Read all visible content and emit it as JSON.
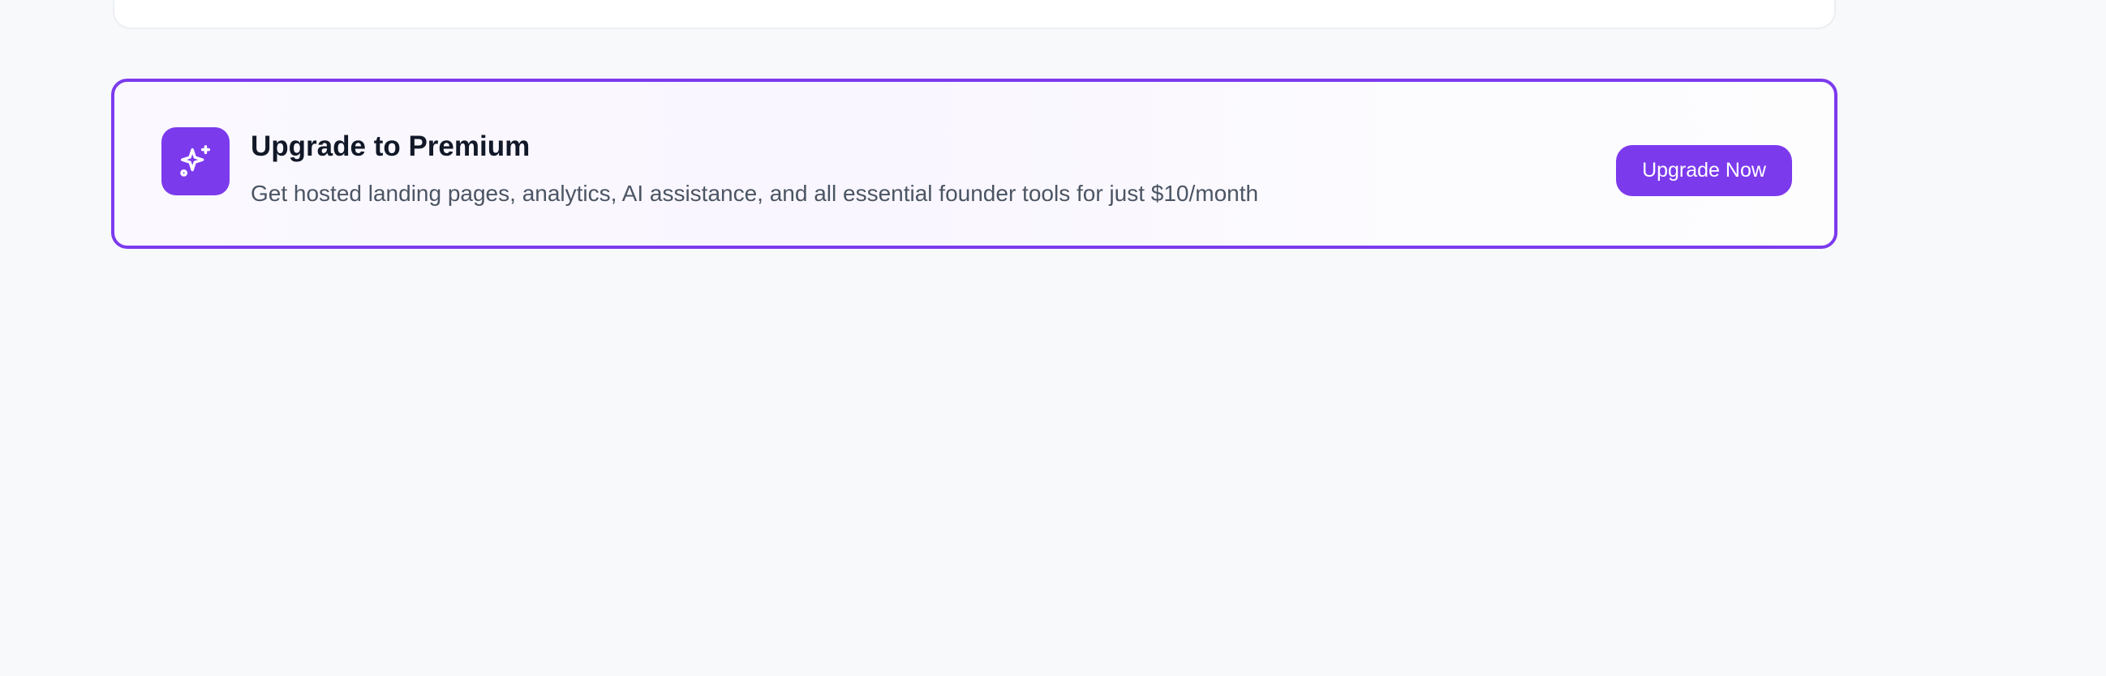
{
  "premium_banner": {
    "title": "Upgrade to Premium",
    "description": "Get hosted landing pages, analytics, AI assistance, and all essential founder tools for just $10/month",
    "button_label": "Upgrade Now",
    "icon": "sparkles-icon"
  },
  "colors": {
    "accent": "#7c3aed",
    "title_text": "#111827",
    "body_text": "#4b5563",
    "page_background": "#f8f9fb"
  }
}
